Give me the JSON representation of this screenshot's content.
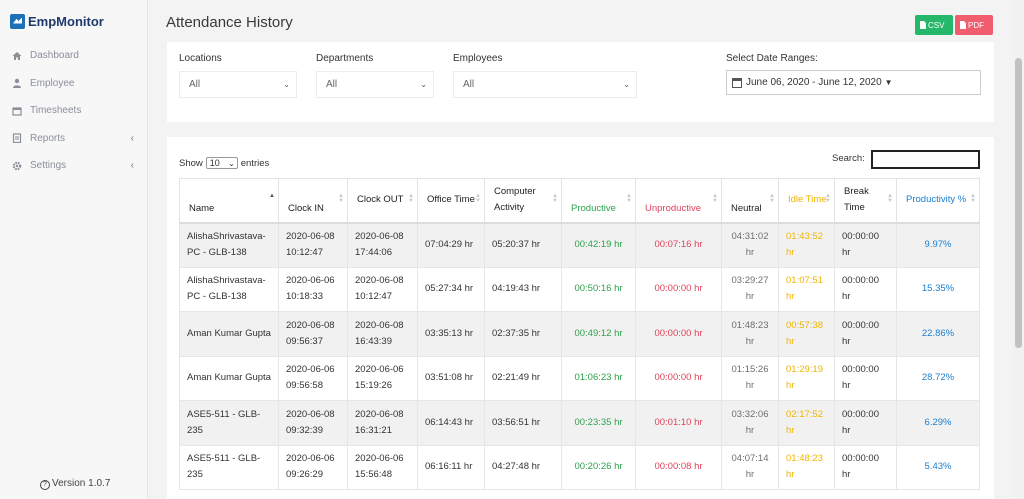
{
  "app": {
    "brand": "EmpMonitor",
    "version": "Version 1.0.7"
  },
  "sidebar": {
    "items": [
      {
        "label": "Dashboard",
        "icon": "home-icon",
        "has_submenu": false
      },
      {
        "label": "Employee",
        "icon": "user-icon",
        "has_submenu": false
      },
      {
        "label": "Timesheets",
        "icon": "calendar-icon",
        "has_submenu": false
      },
      {
        "label": "Reports",
        "icon": "report-icon",
        "has_submenu": true
      },
      {
        "label": "Settings",
        "icon": "gear-icon",
        "has_submenu": true
      }
    ],
    "submenu_chevron": "‹"
  },
  "header": {
    "title": "Attendance History",
    "csv_label": "CSV",
    "pdf_label": "PDF"
  },
  "filters": {
    "locations": {
      "label": "Locations",
      "value": "All"
    },
    "departments": {
      "label": "Departments",
      "value": "All"
    },
    "employees": {
      "label": "Employees",
      "value": "All"
    },
    "date_range": {
      "label": "Select Date Ranges:",
      "value": "June 06, 2020 - June 12, 2020"
    }
  },
  "table": {
    "show_label": "Show",
    "entries_value": "10",
    "entries_label": "entries",
    "search_label": "Search:",
    "columns": [
      "Name",
      "Clock IN",
      "Clock OUT",
      "Office Time",
      "Computer Activity",
      "Productive",
      "Unproductive",
      "Neutral",
      "Idle Time",
      "Break Time",
      "Productivity %"
    ],
    "rows": [
      [
        "AlishaShrivastava-PC - GLB-138",
        "2020-06-08 10:12:47",
        "2020-06-08 17:44:06",
        "07:04:29 hr",
        "05:20:37 hr",
        "00:42:19 hr",
        "00:07:16 hr",
        "04:31:02 hr",
        "01:43:52 hr",
        "00:00:00 hr",
        "9.97%"
      ],
      [
        "AlishaShrivastava-PC - GLB-138",
        "2020-06-06 10:18:33",
        "2020-06-08 10:12:47",
        "05:27:34 hr",
        "04:19:43 hr",
        "00:50:16 hr",
        "00:00:00 hr",
        "03:29:27 hr",
        "01:07:51 hr",
        "00:00:00 hr",
        "15.35%"
      ],
      [
        "Aman Kumar Gupta",
        "2020-06-08 09:56:37",
        "2020-06-08 16:43:39",
        "03:35:13 hr",
        "02:37:35 hr",
        "00:49:12 hr",
        "00:00:00 hr",
        "01:48:23 hr",
        "00:57:38 hr",
        "00:00:00 hr",
        "22.86%"
      ],
      [
        "Aman Kumar Gupta",
        "2020-06-06 09:56:58",
        "2020-06-06 15:19:26",
        "03:51:08 hr",
        "02:21:49 hr",
        "01:06:23 hr",
        "00:00:00 hr",
        "01:15:26 hr",
        "01:29:19 hr",
        "00:00:00 hr",
        "28.72%"
      ],
      [
        "ASE5-511 - GLB-235",
        "2020-06-08 09:32:39",
        "2020-06-08 16:31:21",
        "06:14:43 hr",
        "03:56:51 hr",
        "00:23:35 hr",
        "00:01:10 hr",
        "03:32:06 hr",
        "02:17:52 hr",
        "00:00:00 hr",
        "6.29%"
      ],
      [
        "ASE5-511 - GLB-235",
        "2020-06-06 09:26:29",
        "2020-06-06 15:56:48",
        "06:16:11 hr",
        "04:27:48 hr",
        "00:20:26 hr",
        "00:00:08 hr",
        "04:07:14 hr",
        "01:48:23 hr",
        "00:00:00 hr",
        "5.43%"
      ]
    ]
  },
  "colors": {
    "productive": "#2da24a",
    "unproductive": "#e0435a",
    "idle": "#f0b400",
    "productivity": "#1a7fd0",
    "csv_button": "#26b86a",
    "pdf_button": "#ef5d6e"
  }
}
